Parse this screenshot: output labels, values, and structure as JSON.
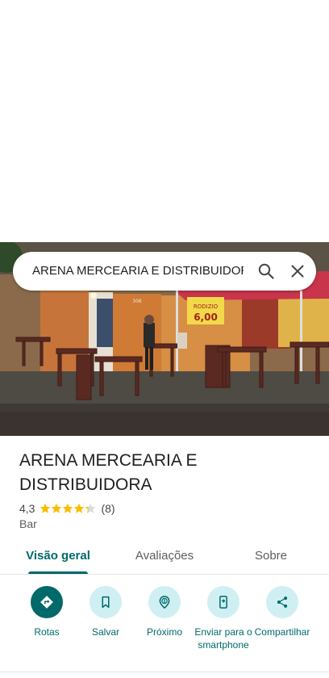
{
  "search": {
    "query": "ARENA MERCEARIA E DISTRIBUIDORA"
  },
  "photo": {
    "alt_icon": "storefront-photo",
    "sign_text": "RODIZIO",
    "price_text": "6,00",
    "number_text": "306"
  },
  "place": {
    "name": "ARENA MERCEARIA E DISTRIBUIDORA",
    "rating": "4,3",
    "rating_stars": 4.3,
    "review_count": "(8)",
    "category": "Bar"
  },
  "tabs": [
    {
      "label": "Visão geral",
      "active": true
    },
    {
      "label": "Avaliações",
      "active": false
    },
    {
      "label": "Sobre",
      "active": false
    }
  ],
  "actions": [
    {
      "label": "Rotas",
      "icon": "directions-icon"
    },
    {
      "label": "Salvar",
      "icon": "bookmark-icon"
    },
    {
      "label": "Próximo",
      "icon": "nearby-icon"
    },
    {
      "label": "Enviar para o smartphone",
      "icon": "send-to-phone-icon"
    },
    {
      "label": "Compartilhar",
      "icon": "share-icon"
    }
  ],
  "colors": {
    "accent": "#00696a",
    "accent_light": "#cfeff3",
    "star": "#fbbc04"
  }
}
